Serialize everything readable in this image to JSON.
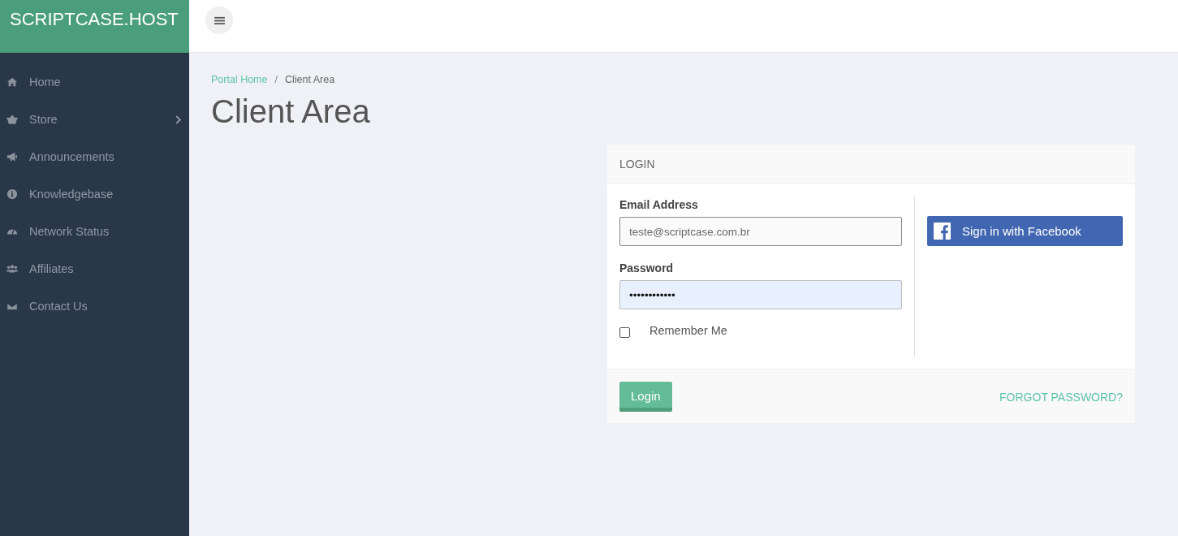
{
  "brand": "SCRIPTCASE.HOST",
  "sidebar": {
    "items": [
      {
        "label": "Home",
        "kind": "home",
        "has_submenu": false
      },
      {
        "label": "Store",
        "kind": "basket",
        "has_submenu": true
      },
      {
        "label": "Announcements",
        "kind": "megaphone",
        "has_submenu": false
      },
      {
        "label": "Knowledgebase",
        "kind": "info",
        "has_submenu": false
      },
      {
        "label": "Network Status",
        "kind": "gauge",
        "has_submenu": false
      },
      {
        "label": "Affiliates",
        "kind": "users",
        "has_submenu": false
      },
      {
        "label": "Contact Us",
        "kind": "envelope",
        "has_submenu": false
      }
    ]
  },
  "breadcrumb": [
    {
      "label": "Portal Home",
      "link": true
    },
    {
      "label": "/",
      "link": false
    },
    {
      "label": "Client Area",
      "link": false
    }
  ],
  "page_title": "Client Area",
  "login_panel": {
    "title": "LOGIN",
    "email": {
      "label": "Email Address",
      "value": "teste@scriptcase.com.br"
    },
    "password": {
      "label": "Password",
      "value": "••••••••••••"
    },
    "remember": {
      "label": "Remember Me",
      "checked": false
    },
    "facebook_button": "Sign in with Facebook",
    "login_button": "Login",
    "forgot_link": "FORGOT PASSWORD?"
  }
}
